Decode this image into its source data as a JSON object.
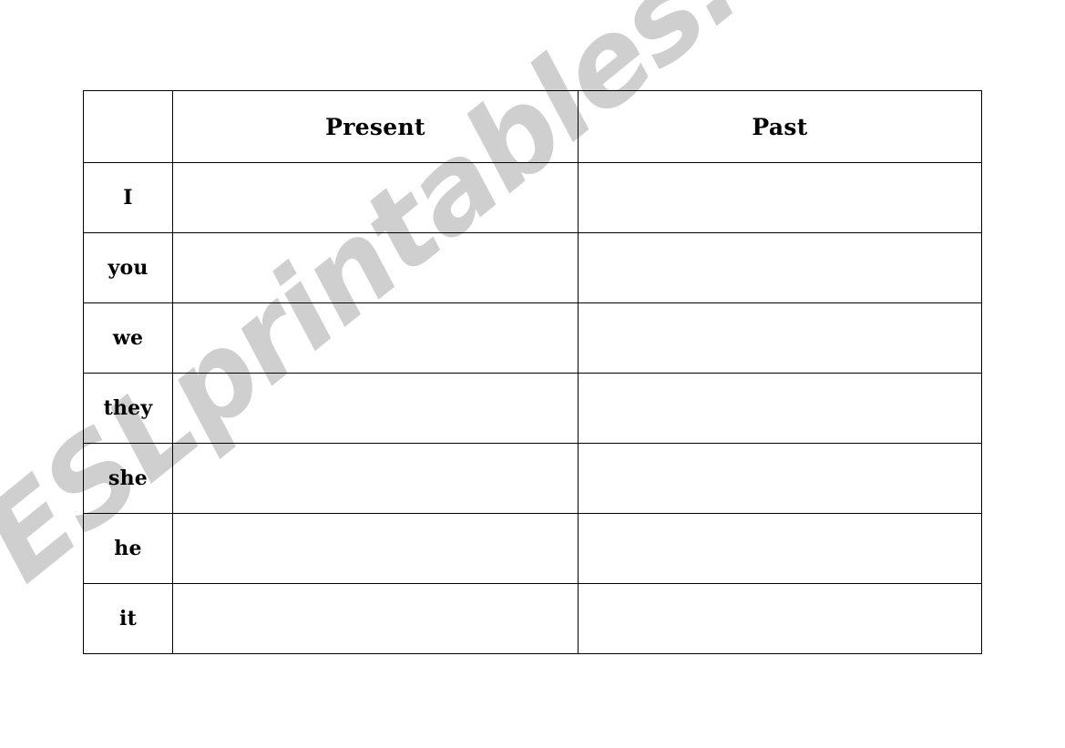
{
  "worksheet": {
    "watermark": "ESLprintables.com",
    "watermark_color": "#cfcfcf",
    "table": {
      "corner_header": "",
      "columns": [
        {
          "key": "pronoun",
          "label": ""
        },
        {
          "key": "present",
          "label": "Present"
        },
        {
          "key": "past",
          "label": "Past"
        }
      ],
      "rows": [
        {
          "pronoun": "I",
          "present": "",
          "past": ""
        },
        {
          "pronoun": "you",
          "present": "",
          "past": ""
        },
        {
          "pronoun": "we",
          "present": "",
          "past": ""
        },
        {
          "pronoun": "they",
          "present": "",
          "past": ""
        },
        {
          "pronoun": "she",
          "present": "",
          "past": ""
        },
        {
          "pronoun": "he",
          "present": "",
          "past": ""
        },
        {
          "pronoun": "it",
          "present": "",
          "past": ""
        }
      ]
    }
  }
}
